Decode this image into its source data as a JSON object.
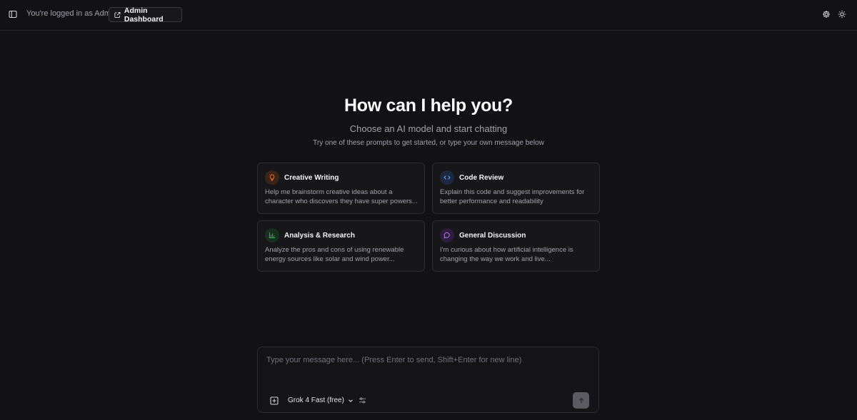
{
  "header": {
    "login_text": "You're logged in as Admin",
    "admin_button_label": "Admin Dashboard",
    "icons": [
      "sidebar-toggle-icon",
      "external-link-icon",
      "gear-icon",
      "sun-icon"
    ]
  },
  "hero": {
    "title": "How can I help you?",
    "subtitle": "Choose an AI model and start chatting",
    "hint": "Try one of these prompts to get started, or type your own message below"
  },
  "prompts": [
    {
      "title": "Creative Writing",
      "body": "Help me brainstorm creative ideas about a character who discovers they have super powers...",
      "icon": "lightbulb-icon",
      "color": "#f97316"
    },
    {
      "title": "Code Review",
      "body": "Explain this code and suggest improvements for better performance and readability",
      "icon": "code-icon",
      "color": "#60a5fa"
    },
    {
      "title": "Analysis & Research",
      "body": "Analyze the pros and cons of using renewable energy sources like solar and wind power...",
      "icon": "bar-chart-icon",
      "color": "#22c55e"
    },
    {
      "title": "General Discussion",
      "body": "I'm curious about how artificial intelligence is changing the way we work and live...",
      "icon": "chat-bubble-icon",
      "color": "#c084fc"
    }
  ],
  "composer": {
    "placeholder": "Type your message here... (Press Enter to send, Shift+Enter for new line)",
    "value": "",
    "model_label": "Grok 4 Fast (free)",
    "icons": [
      "attach-plus-icon",
      "chevron-down-icon",
      "sliders-icon",
      "arrow-up-icon"
    ]
  }
}
